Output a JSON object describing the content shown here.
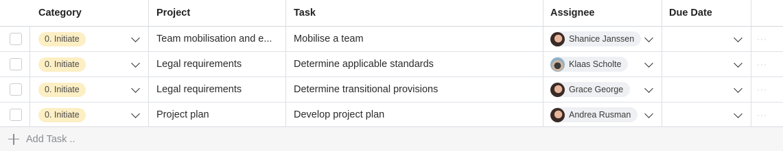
{
  "columns": {
    "category": "Category",
    "project": "Project",
    "task": "Task",
    "assignee": "Assignee",
    "due_date": "Due Date"
  },
  "rows": [
    {
      "category": "0. Initiate",
      "project": "Team mobilisation and e...",
      "task": "Mobilise a team",
      "assignee": "Shanice Janssen",
      "avatar": "woman-avatar",
      "due_date": ""
    },
    {
      "category": "0. Initiate",
      "project": "Legal requirements",
      "task": "Determine applicable standards",
      "assignee": "Klaas Scholte",
      "avatar": "man-avatar",
      "due_date": ""
    },
    {
      "category": "0. Initiate",
      "project": "Legal requirements",
      "task": "Determine transitional provisions",
      "assignee": "Grace George",
      "avatar": "woman-avatar",
      "due_date": ""
    },
    {
      "category": "0. Initiate",
      "project": "Project plan",
      "task": "Develop project plan",
      "assignee": "Andrea Rusman",
      "avatar": "woman-avatar",
      "due_date": ""
    }
  ],
  "footer": {
    "add_task_label": "Add Task .."
  },
  "colors": {
    "category_badge": "#fdefc4",
    "assignee_pill": "#eef0f3",
    "footer_bg": "#f6f6f7"
  }
}
